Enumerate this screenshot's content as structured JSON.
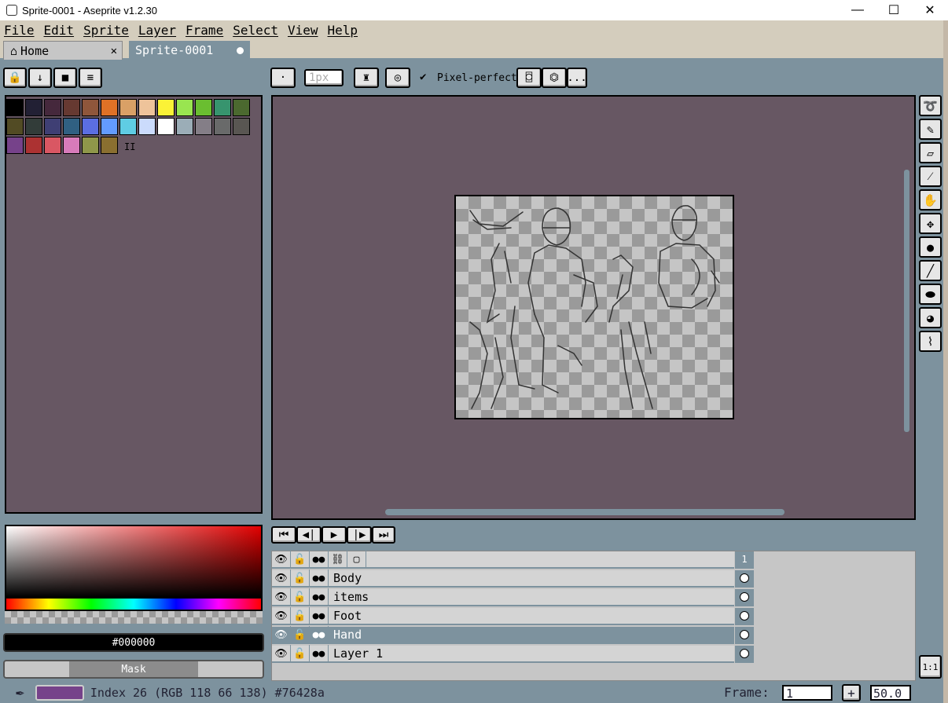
{
  "window": {
    "title": "Sprite-0001 - Aseprite v1.2.30",
    "minimize": "—",
    "maximize": "☐",
    "close": "✕"
  },
  "menu": [
    "File",
    "Edit",
    "Sprite",
    "Layer",
    "Frame",
    "Select",
    "View",
    "Help"
  ],
  "tabs": {
    "home": "Home",
    "home_icon": "home-icon",
    "home_close": "✕",
    "sprite": "Sprite-0001"
  },
  "left_buttons": [
    "🔒",
    "↓",
    "■",
    "≡"
  ],
  "toolbar": {
    "brush_size": "1px",
    "pixel_perfect_check": "✔",
    "pixel_perfect": "Pixel-perfect",
    "more": "..."
  },
  "palette": {
    "colors": [
      "#000000",
      "#222034",
      "#45283c",
      "#663931",
      "#8f563b",
      "#df7126",
      "#d9a066",
      "#eec39a",
      "#fbf236",
      "#99e550",
      "#6abe30",
      "#37946e",
      "#4b692f",
      "#524b24",
      "#323c39",
      "#3f3f74",
      "#306082",
      "#5b6ee1",
      "#639bff",
      "#5fcde4",
      "#cbdbfc",
      "#ffffff",
      "#9badb7",
      "#847e87",
      "#696a6a",
      "#595652",
      "#76428a",
      "#ac3232",
      "#d95763",
      "#d77bba",
      "#8f974a",
      "#8a6f30"
    ],
    "pause_marker": "II"
  },
  "right_tools": [
    "lasso-icon",
    "pencil-icon",
    "eraser-icon",
    "eyedropper-icon",
    "hand-icon",
    "move-icon",
    "paint-bucket-icon",
    "line-icon",
    "ellipse-icon",
    "contour-icon",
    "blur-icon"
  ],
  "right_tool_glyphs": [
    "➰",
    "✎",
    "▱",
    "⁄",
    "✋",
    "✥",
    "●",
    "╱",
    "⬬",
    "◕",
    "⌇"
  ],
  "timeline": {
    "nav": [
      "⏮",
      "◀|",
      "▶",
      "|▶",
      "⏭"
    ],
    "header_frame": "1",
    "header_icons": [
      "👁",
      "🔓",
      "●●",
      "⛓",
      "▢"
    ],
    "layers": [
      {
        "name": "Body",
        "selected": false
      },
      {
        "name": "items",
        "selected": false
      },
      {
        "name": "Foot",
        "selected": false
      },
      {
        "name": "Hand",
        "selected": true
      },
      {
        "name": "Layer 1",
        "selected": false
      }
    ],
    "zoom_fit": "1:1"
  },
  "color": {
    "hex_label": "#000000",
    "mask_label": "Mask"
  },
  "status": {
    "text": "Index 26 (RGB 118 66 138) #76428a",
    "current_color": "#76428a",
    "frame_label": "Frame:",
    "frame_value": "1",
    "add": "+",
    "zoom": "50.0"
  }
}
